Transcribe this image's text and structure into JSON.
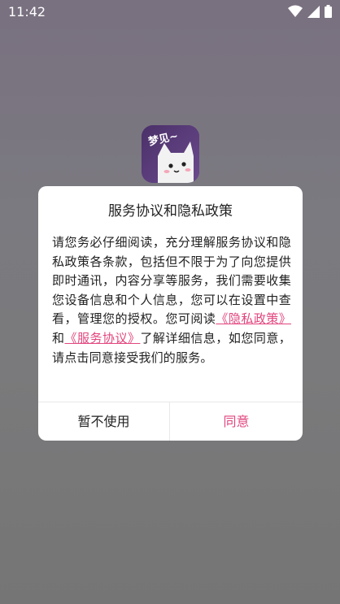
{
  "status_bar": {
    "time": "11:42",
    "icons": [
      "wifi-icon",
      "signal-icon",
      "battery-icon"
    ]
  },
  "app": {
    "icon_text": "梦见~"
  },
  "dialog": {
    "title": "服务协议和隐私政策",
    "body_lead": "请您务必仔细阅读，充分理解服务协议和隐私政策各条款，包括但不限于为了向您提供即时通讯，内容分享等服务，我们需要收集您设备信息和个人信息，您可以在设置中查看，管理您的授权。您可阅读",
    "privacy_link": "《隐私政策》",
    "conjunction": "和",
    "service_link": "《服务协议》",
    "body_tail": "了解详细信息，如您同意，请点击同意接受我们的服务。",
    "decline_button": "暂不使用",
    "agree_button": "同意"
  },
  "colors": {
    "accent": "#e2457d",
    "overlay": "#7a7a7c"
  }
}
